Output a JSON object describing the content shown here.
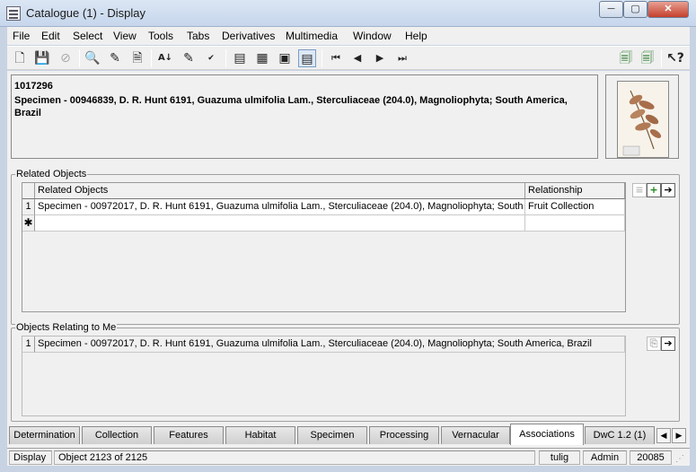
{
  "window": {
    "title": "Catalogue (1) - Display",
    "minimize": "─",
    "maximize": "▢",
    "close": "✕"
  },
  "menu": {
    "items": [
      "File",
      "Edit",
      "Select",
      "View",
      "Tools",
      "Tabs",
      "Derivatives",
      "Multimedia",
      "Window",
      "Help"
    ]
  },
  "toolbar": {
    "icons": [
      "new-icon",
      "save-icon",
      "cancel-icon",
      "search-icon",
      "search-replace-icon",
      "search-fields-icon",
      "sort-icon",
      "edit-icon",
      "spellcheck-icon",
      "page-view-icon",
      "list-view-icon",
      "record-view-icon",
      "summary-view-icon",
      "first-record-icon",
      "previous-record-icon",
      "next-record-icon",
      "last-record-icon",
      "copy-record-icon",
      "copy-all-icon",
      "context-help-icon"
    ]
  },
  "header": {
    "id": "1017296",
    "description": "Specimen - 00946839, D. R. Hunt 6191, Guazuma ulmifolia Lam., Sterculiaceae (204.0), Magnoliophyta;  South America, Brazil"
  },
  "related_objects": {
    "title": "Related Objects",
    "columns": [
      "Related Objects",
      "Relationship"
    ],
    "rows": [
      {
        "num": "1",
        "object": "Specimen - 00972017, D. R. Hunt 6191, Guazuma ulmifolia Lam., Sterculiaceae (204.0), Magnoliophyta;  South ...",
        "relationship": "Fruit Collection"
      }
    ],
    "new_row_marker": "✱"
  },
  "objects_relating": {
    "title": "Objects Relating to Me",
    "rows": [
      {
        "num": "1",
        "object": "Specimen - 00972017, D. R. Hunt 6191, Guazuma ulmifolia Lam., Sterculiaceae (204.0), Magnoliophyta;  South America, Brazil"
      }
    ]
  },
  "tabs": [
    "Determination",
    "Collection",
    "Features",
    "Habitat",
    "Specimen",
    "Processing",
    "Vernacular",
    "Associations",
    "DwC 1.2 (1)"
  ],
  "active_tab": "Associations",
  "status": {
    "mode": "Display",
    "position": "Object 2123 of 2125",
    "user": "tulig",
    "group": "Admin",
    "number": "20085"
  }
}
